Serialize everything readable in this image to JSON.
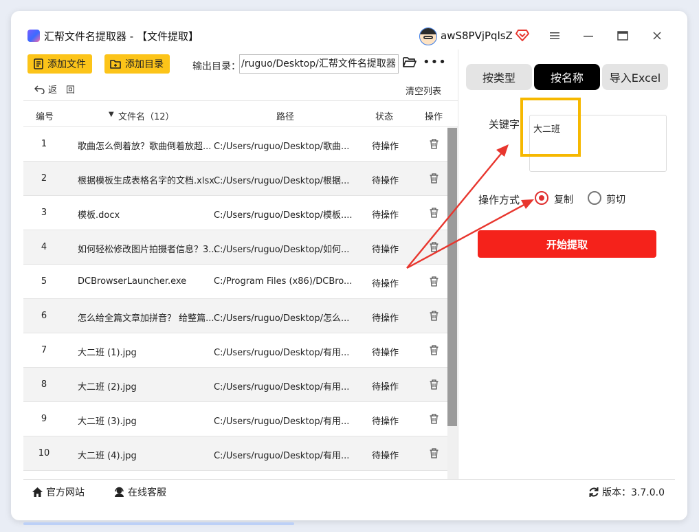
{
  "titlebar": {
    "app_icon": "app-logo-icon",
    "title": "汇帮文件名提取器 - 【文件提取】",
    "username": "awS8PVjPqlsZ",
    "vip_icon": "vip-diamond-icon",
    "window_buttons": [
      "menu-icon",
      "minimize-icon",
      "maximize-icon",
      "close-icon"
    ]
  },
  "toolbar": {
    "add_file_label": "添加文件",
    "add_dir_label": "添加目录",
    "output_label": "输出目录：",
    "output_path": "/ruguo/Desktop/汇帮文件名提取器",
    "folder_icon": "folder-open-icon",
    "more_icon": "more-dots-icon",
    "more_glyph": "•••"
  },
  "list_actions": {
    "back_label": "返　回",
    "clear_label": "清空列表"
  },
  "table": {
    "headers": {
      "num": "编号",
      "sort_glyph": "▼",
      "name": "文件名（12）",
      "path": "路径",
      "status": "状态",
      "action": "操作"
    },
    "rows": [
      {
        "num": "1",
        "name": "歌曲怎么倒着放？歌曲倒着放超...",
        "path": "C:/Users/ruguo/Desktop/歌曲...",
        "status": "待操作"
      },
      {
        "num": "2",
        "name": "根据模板生成表格名字的文档.xlsx",
        "path": "C:/Users/ruguo/Desktop/根据...",
        "status": "待操作"
      },
      {
        "num": "3",
        "name": "模板.docx",
        "path": "C:/Users/ruguo/Desktop/模板....",
        "status": "待操作"
      },
      {
        "num": "4",
        "name": "如何轻松修改图片拍摄者信息？3...",
        "path": "C:/Users/ruguo/Desktop/如何...",
        "status": "待操作"
      },
      {
        "num": "5",
        "name": "DCBrowserLauncher.exe",
        "path": "C:/Program Files (x86)/DCBro...",
        "status": "待操作"
      },
      {
        "num": "6",
        "name": "怎么给全篇文章加拼音？ 给整篇...",
        "path": "C:/Users/ruguo/Desktop/怎么...",
        "status": "待操作"
      },
      {
        "num": "7",
        "name": "大二班 (1).jpg",
        "path": "C:/Users/ruguo/Desktop/有用...",
        "status": "待操作"
      },
      {
        "num": "8",
        "name": "大二班 (2).jpg",
        "path": "C:/Users/ruguo/Desktop/有用...",
        "status": "待操作"
      },
      {
        "num": "9",
        "name": "大二班 (3).jpg",
        "path": "C:/Users/ruguo/Desktop/有用...",
        "status": "待操作"
      },
      {
        "num": "10",
        "name": "大二班 (4).jpg",
        "path": "C:/Users/ruguo/Desktop/有用...",
        "status": "待操作"
      }
    ]
  },
  "right_panel": {
    "tabs": [
      {
        "label": "按类型",
        "active": false
      },
      {
        "label": "按名称",
        "active": true
      },
      {
        "label": "导入Excel",
        "active": false
      }
    ],
    "keyword_label": "关键字",
    "keyword_value": "大二班",
    "operation_label": "操作方式",
    "options": [
      {
        "label": "复制",
        "selected": true
      },
      {
        "label": "剪切",
        "selected": false
      }
    ],
    "start_label": "开始提取"
  },
  "footer": {
    "website_label": "官方网站",
    "service_label": "在线客服",
    "version_label": "版本：3.7.0.0"
  },
  "colors": {
    "accent_yellow": "#fcc419",
    "highlight_yellow": "#f6b800",
    "primary_red": "#f5221b",
    "annotation_red": "#e8362e",
    "active_tab": "#000000"
  }
}
